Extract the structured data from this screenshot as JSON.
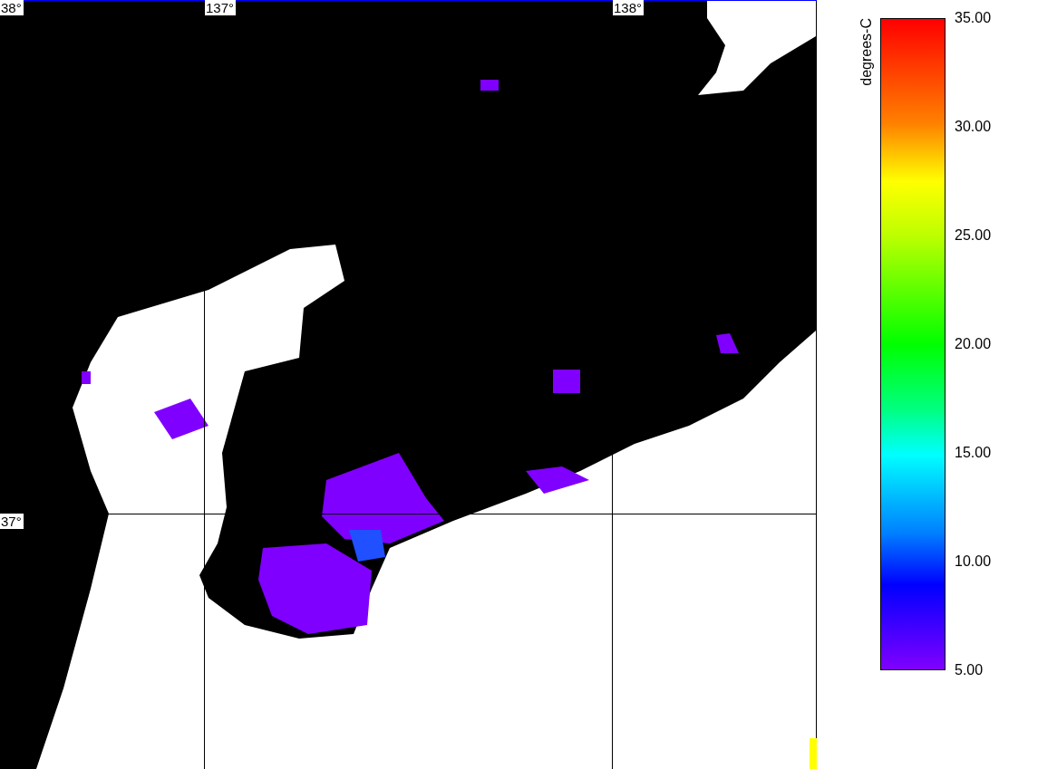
{
  "map": {
    "latitude_labels": [
      "38°",
      "37°"
    ],
    "longitude_labels": [
      "137°",
      "138°"
    ]
  },
  "colorbar": {
    "title": "degrees-C",
    "tick_labels": [
      "35.00",
      "30.00",
      "25.00",
      "20.00",
      "15.00",
      "10.00",
      "5.00"
    ]
  }
}
